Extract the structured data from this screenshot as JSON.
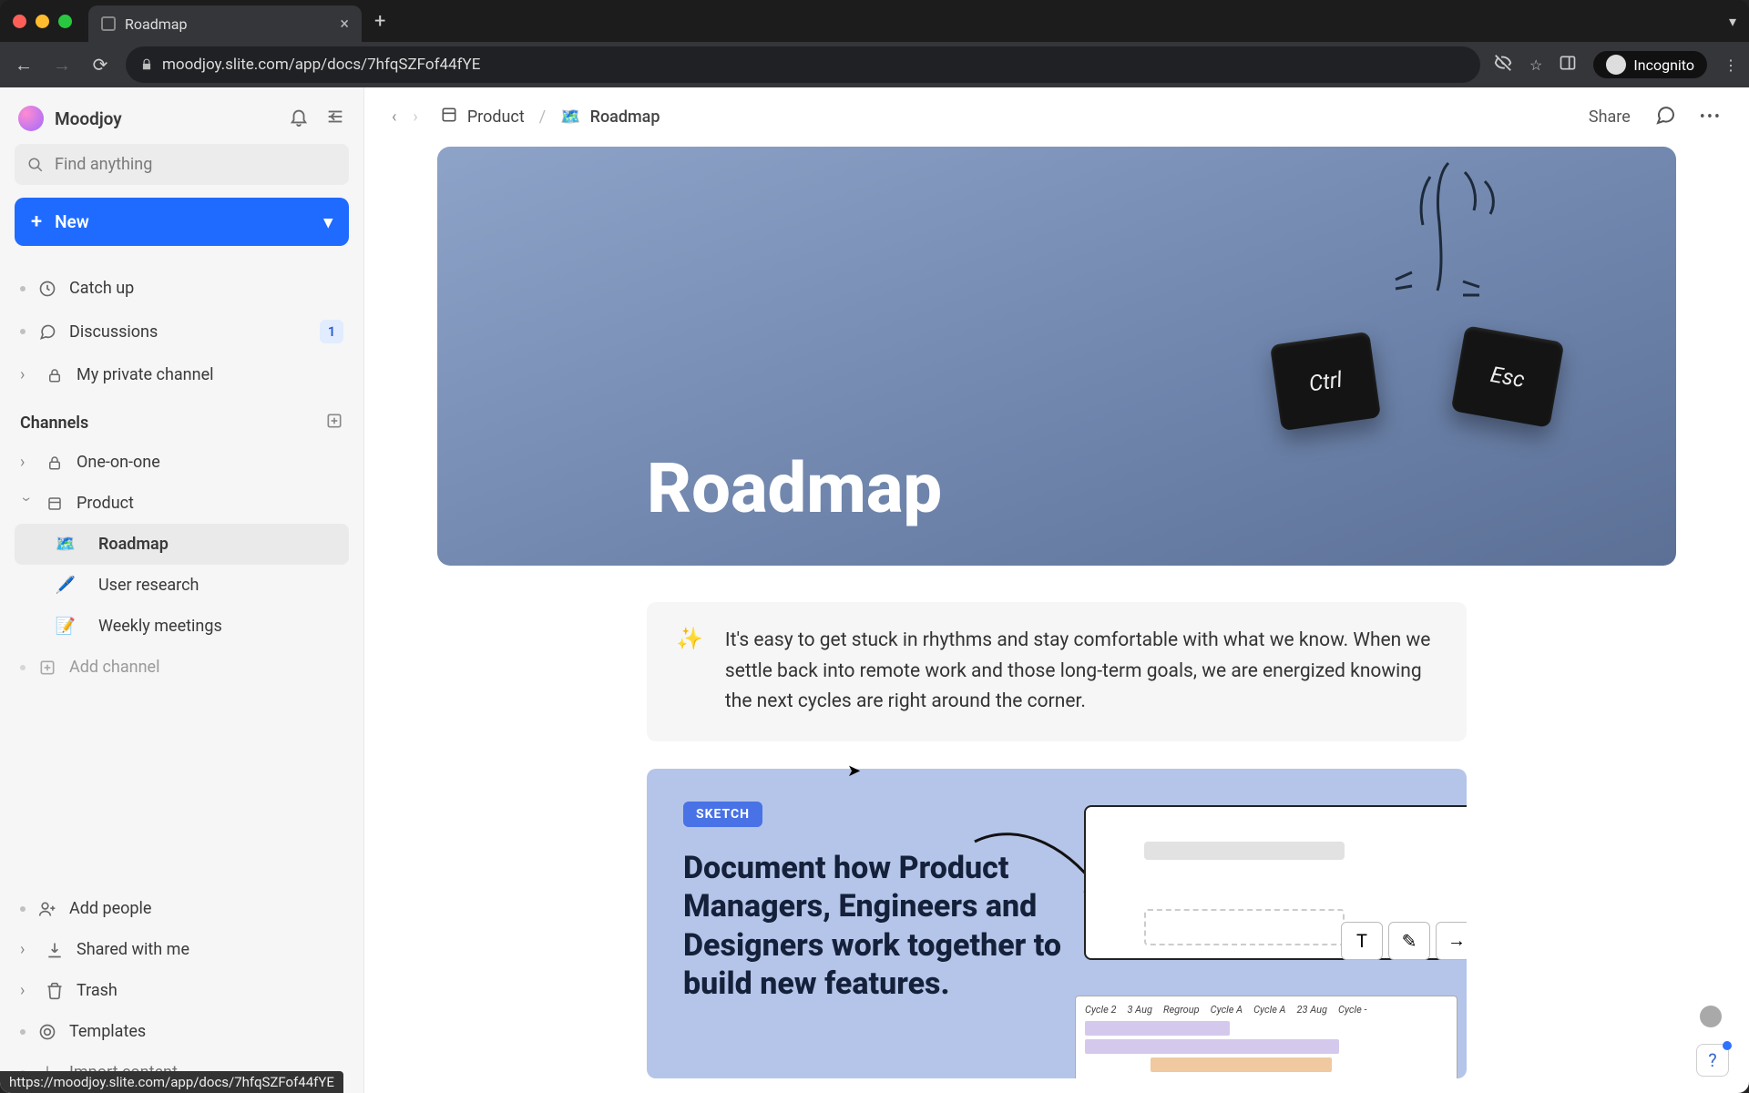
{
  "browser": {
    "tab_title": "Roadmap",
    "url": "moodjoy.slite.com/app/docs/7hfqSZFof44fYE",
    "incognito_label": "Incognito",
    "status_url": "https://moodjoy.slite.com/app/docs/7hfqSZFof44fYE"
  },
  "workspace": {
    "name": "Moodjoy"
  },
  "search": {
    "placeholder": "Find anything"
  },
  "new_button": {
    "label": "New"
  },
  "nav": {
    "catch_up": "Catch up",
    "discussions": "Discussions",
    "discussions_badge": "1",
    "private": "My private channel"
  },
  "channels_heading": "Channels",
  "channels": {
    "one_on_one": "One-on-one",
    "product": "Product",
    "product_children": {
      "roadmap": {
        "icon": "🗺️",
        "label": "Roadmap"
      },
      "research": {
        "icon": "🖊️",
        "label": "User research"
      },
      "weekly": {
        "icon": "📝",
        "label": "Weekly meetings"
      }
    },
    "add_channel": "Add channel"
  },
  "sidebar_footer": {
    "add_people": "Add people",
    "shared": "Shared with me",
    "trash": "Trash",
    "templates": "Templates",
    "import": "Import content"
  },
  "breadcrumb": {
    "parent": "Product",
    "current_icon": "🗺️",
    "current": "Roadmap"
  },
  "topbar": {
    "share": "Share"
  },
  "doc": {
    "title": "Roadmap",
    "key_ctrl": "Ctrl",
    "key_esc": "Esc",
    "callout_icon": "✨",
    "callout_text": "It's easy to get stuck in rhythms and stay comfortable with what we know. When we settle back into remote work and those long-term goals, we are energized knowing the next cycles are right around the corner.",
    "sketch_label": "SKETCH",
    "sketch_text": "Document how Product Managers, Engineers and Designers work together to build new features.",
    "gantt": [
      "Cycle 2",
      "3 Aug",
      "Regroup",
      "Cycle A",
      "Cycle A",
      "23 Aug",
      "Cycle -"
    ]
  }
}
